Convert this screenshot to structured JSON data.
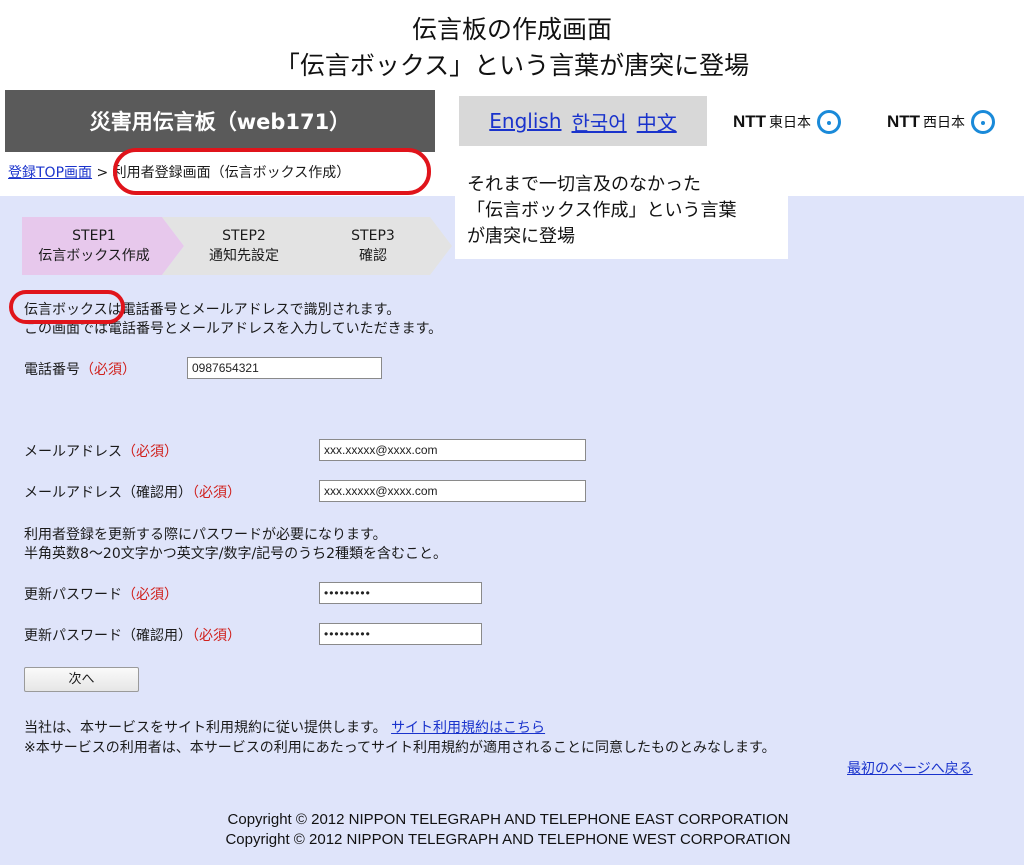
{
  "slide": {
    "title_line1": "伝言板の作成画面",
    "title_line2": "「伝言ボックス」という言葉が唐突に登場"
  },
  "header": {
    "brand": "災害用伝言板（web171）",
    "languages": [
      "English",
      "한국어",
      "中文"
    ],
    "logos": [
      {
        "name": "NTT",
        "region": "東日本"
      },
      {
        "name": "NTT",
        "region": "西日本"
      }
    ]
  },
  "breadcrumb": {
    "home": "登録TOP画面",
    "separator": ">",
    "current": "利用者登録画面（伝言ボックス作成）"
  },
  "callout": {
    "line1": "それまで一切言及のなかった",
    "line2": "「伝言ボックス作成」という言葉",
    "line3": "が唐突に登場"
  },
  "steps": [
    {
      "label": "STEP1",
      "sub": "伝言ボックス作成",
      "active": true
    },
    {
      "label": "STEP2",
      "sub": "通知先設定",
      "active": false
    },
    {
      "label": "STEP3",
      "sub": "確認",
      "active": false
    }
  ],
  "intro": {
    "line1_prefix": "伝言ボックス",
    "line1_rest": "は電話番号とメールアドレスで識別されます。",
    "line2": "この画面では電話番号とメールアドレスを入力していただきます。"
  },
  "form": {
    "required_tag": "（必須）",
    "phone": {
      "label": "電話番号",
      "value": "0987654321"
    },
    "email": {
      "label": "メールアドレス",
      "value": "xxx.xxxxx@xxxx.com"
    },
    "email_confirm": {
      "label": "メールアドレス（確認用）",
      "value": "xxx.xxxxx@xxxx.com"
    },
    "password_note_line1": "利用者登録を更新する際にパスワードが必要になります。",
    "password_note_line2": "半角英数8〜20文字かつ英文字/数字/記号のうち2種類を含むこと。",
    "password": {
      "label": "更新パスワード",
      "value": "•••••••••"
    },
    "password_confirm": {
      "label": "更新パスワード（確認用）",
      "value": "•••••••••"
    },
    "next_button": "次へ"
  },
  "terms": {
    "line1": "当社は、本サービスをサイト利用規約に従い提供します。",
    "link": "サイト利用規約はこちら",
    "line2": "※本サービスの利用者は、本サービスの利用にあたってサイト利用規約が適用されることに同意したものとみなします。",
    "back_link": "最初のページへ戻る"
  },
  "footer": {
    "copyright_east": "Copyright © 2012 NIPPON TELEGRAPH AND TELEPHONE EAST CORPORATION",
    "copyright_west": "Copyright © 2012 NIPPON TELEGRAPH AND TELEPHONE WEST CORPORATION"
  },
  "colors": {
    "highlight": "#e0141b",
    "page_background": "#dfe4fa",
    "required": "#d0201c",
    "link": "#1a33cc",
    "active_step": "#e7c8ec"
  }
}
